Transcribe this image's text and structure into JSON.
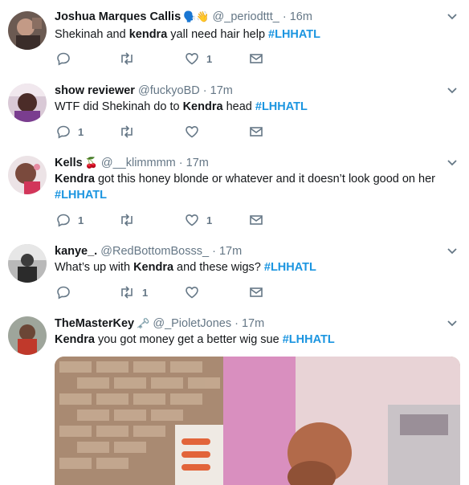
{
  "tweets": [
    {
      "name": "Joshua Marques Callis",
      "emoji": "🗣️👋",
      "handle": "@_periodttt_",
      "time": "16m",
      "text": [
        "Shekinah and ",
        "kendra",
        " yall need hair help ",
        "#LHHATL"
      ],
      "replies": "",
      "retweets": "",
      "likes": "1"
    },
    {
      "name": "show reviewer",
      "emoji": "",
      "handle": "@fuckyoBD",
      "time": "17m",
      "text": [
        "WTF did Shekinah do to ",
        "Kendra",
        " head ",
        "#LHHATL"
      ],
      "replies": "1",
      "retweets": "",
      "likes": ""
    },
    {
      "name": "Kells",
      "emoji": "🍒",
      "handle": "@__klimmmm",
      "time": "17m",
      "text": [
        "",
        "Kendra",
        " got this honey blonde or whatever and it doesn’t look good on her ",
        "#LHHATL"
      ],
      "replies": "1",
      "retweets": "",
      "likes": "1"
    },
    {
      "name": "kanye_.",
      "emoji": "",
      "handle": "@RedBottomBosss_",
      "time": "17m",
      "text": [
        "What’s up with ",
        "Kendra",
        " and these wigs? ",
        "#LHHATL"
      ],
      "replies": "",
      "retweets": "1",
      "likes": ""
    },
    {
      "name": "TheMasterKey",
      "emoji": "🗝️",
      "handle": "@_PioletJones",
      "time": "17m",
      "text": [
        "",
        "Kendra",
        " you got money get a better wig sue ",
        "#LHHATL"
      ],
      "replies": "",
      "retweets": "",
      "likes": ""
    }
  ],
  "separator": " · ",
  "icons": {
    "reply": "reply-icon",
    "retweet": "retweet-icon",
    "like": "heart-icon",
    "dm": "envelope-icon",
    "menu": "chevron-down-icon"
  },
  "colors": {
    "text": "#14171a",
    "secondary": "#657786",
    "hashtag": "#1b95e0",
    "divider": "#e6ecf0"
  }
}
